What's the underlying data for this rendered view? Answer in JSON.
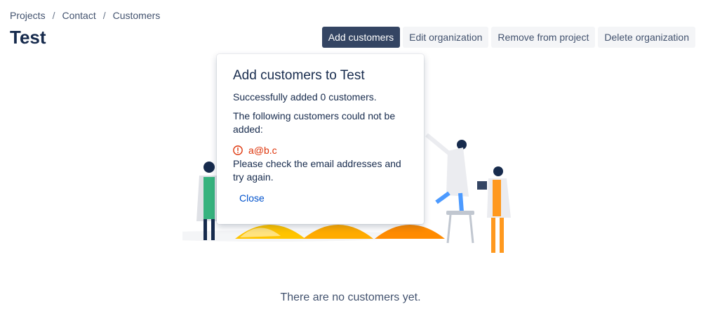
{
  "breadcrumb": {
    "items": [
      "Projects",
      "Contact",
      "Customers"
    ],
    "separator": "/"
  },
  "page": {
    "title": "Test"
  },
  "actions": {
    "add_customers": "Add customers",
    "edit_organization": "Edit organization",
    "remove_from_project": "Remove from project",
    "delete_organization": "Delete organization"
  },
  "modal": {
    "title": "Add customers to Test",
    "success_text": "Successfully added 0 customers.",
    "failure_text": "The following customers could not be added:",
    "failed_email": "a@b.c",
    "error_icon": "error-icon",
    "check_text": "Please check the email addresses and try again.",
    "close_label": "Close"
  },
  "empty_state": {
    "text": "There are no customers yet."
  },
  "colors": {
    "primary_button": "#344563",
    "error": "#de350b",
    "link": "#0052cc"
  }
}
